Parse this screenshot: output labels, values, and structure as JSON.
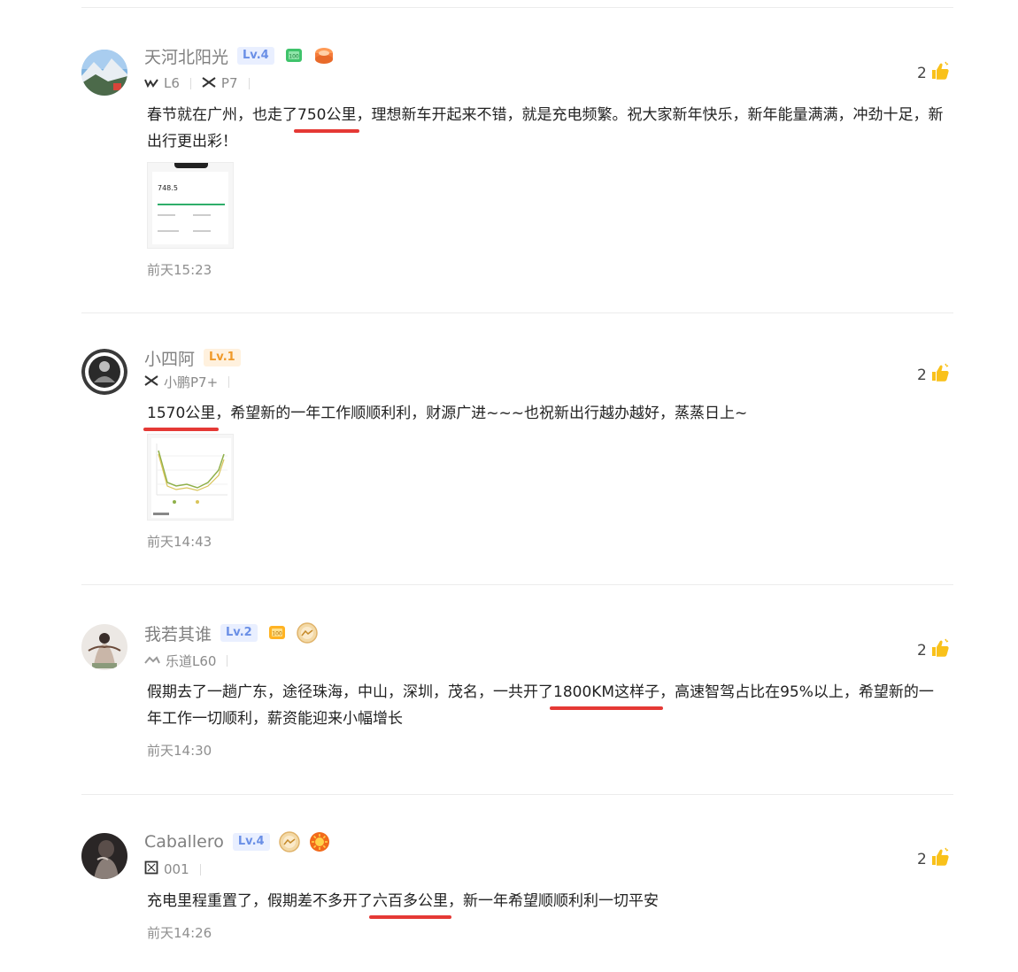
{
  "comments": [
    {
      "username": "天河北阳光",
      "level": "Lv.4",
      "cars": [
        "L6",
        "P7"
      ],
      "text_before": "春节就在广州，也走了",
      "text_highlight": "750公里",
      "text_after": "，理想新车开起来不错，就是充电频繁。祝大家新年快乐，新年能量满满，冲劲十足，新出行更出彩！",
      "thumb_value": "748.5",
      "time": "前天15:23",
      "likes": "2"
    },
    {
      "username": "小四阿",
      "level": "Lv.1",
      "cars": [
        "小鹏P7+"
      ],
      "text_before": "",
      "text_highlight": "1570公里",
      "text_after": "，希望新的一年工作顺顺利利，财源广进~~~也祝新出行越办越好，蒸蒸日上~",
      "time": "前天14:43",
      "likes": "2"
    },
    {
      "username": "我若其谁",
      "level": "Lv.2",
      "cars": [
        "乐道L60"
      ],
      "text_before": "假期去了一趟广东，途径珠海，中山，深圳，茂名，一共开了",
      "text_highlight": "1800KM这样子",
      "text_after": "，高速智驾占比在95%以上，希望新的一年工作一切顺利，薪资能迎来小幅增长",
      "time": "前天14:30",
      "likes": "2"
    },
    {
      "username": "Caballero",
      "level": "Lv.4",
      "cars": [
        "001"
      ],
      "text_before": "充电里程重置了，假期差不多开了",
      "text_highlight": "六百多公里",
      "text_after": "，新一年希望顺顺利利一切平安",
      "time": "前天14:26",
      "likes": "2"
    }
  ]
}
